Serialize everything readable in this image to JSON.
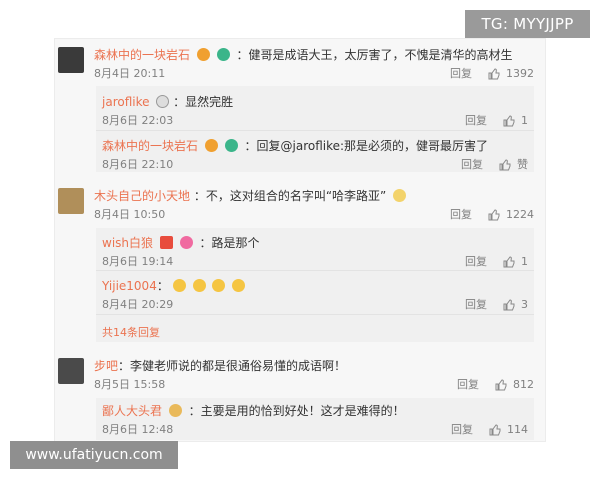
{
  "overlay": {
    "tg_label": "TG: MYYJJPP",
    "watermark": "www.ufatiyucn.com"
  },
  "colors": {
    "username": "#eb7350",
    "meta": "#808080",
    "panel_bg": "#f7f7f7",
    "reply_box_bg": "#f0f0f0"
  },
  "comments": [
    {
      "user": "森林中的一块岩石",
      "text": "：健哥是成语大王，太厉害了，不愧是清华的高材生",
      "date": "8月4日 20:11",
      "reply": "回复",
      "likes": "1392",
      "replies": [
        {
          "user": "jaroflike",
          "text": "：显然完胜",
          "date": "8月6日 22:03",
          "reply": "回复",
          "likes": "1"
        },
        {
          "user": "森林中的一块岩石",
          "text": "：回复@jaroflike:那是必须的，健哥最厉害了",
          "date": "8月6日 22:10",
          "reply": "回复",
          "likes": "赞"
        }
      ]
    },
    {
      "user": "木头自己的小天地",
      "text": "：不，这对组合的名字叫“哈李路亚”",
      "date": "8月4日 10:50",
      "reply": "回复",
      "likes": "1224",
      "replies": [
        {
          "user": "wish白狼",
          "text": "：路是那个",
          "date": "8月6日 19:14",
          "reply": "回复",
          "likes": "1"
        },
        {
          "user": "Yijie1004",
          "text": "：",
          "date": "8月4日 20:29",
          "reply": "回复",
          "likes": "3"
        }
      ],
      "more": "共14条回复"
    },
    {
      "user": "步吧",
      "text": "：李健老师说的都是很通俗易懂的成语啊！",
      "date": "8月5日 15:58",
      "reply": "回复",
      "likes": "812",
      "replies": [
        {
          "user": "鄙人大头君",
          "text": "：主要是用的恰到好处！这才是难得的！",
          "date": "8月6日 12:48",
          "reply": "回复",
          "likes": "114"
        }
      ]
    }
  ]
}
